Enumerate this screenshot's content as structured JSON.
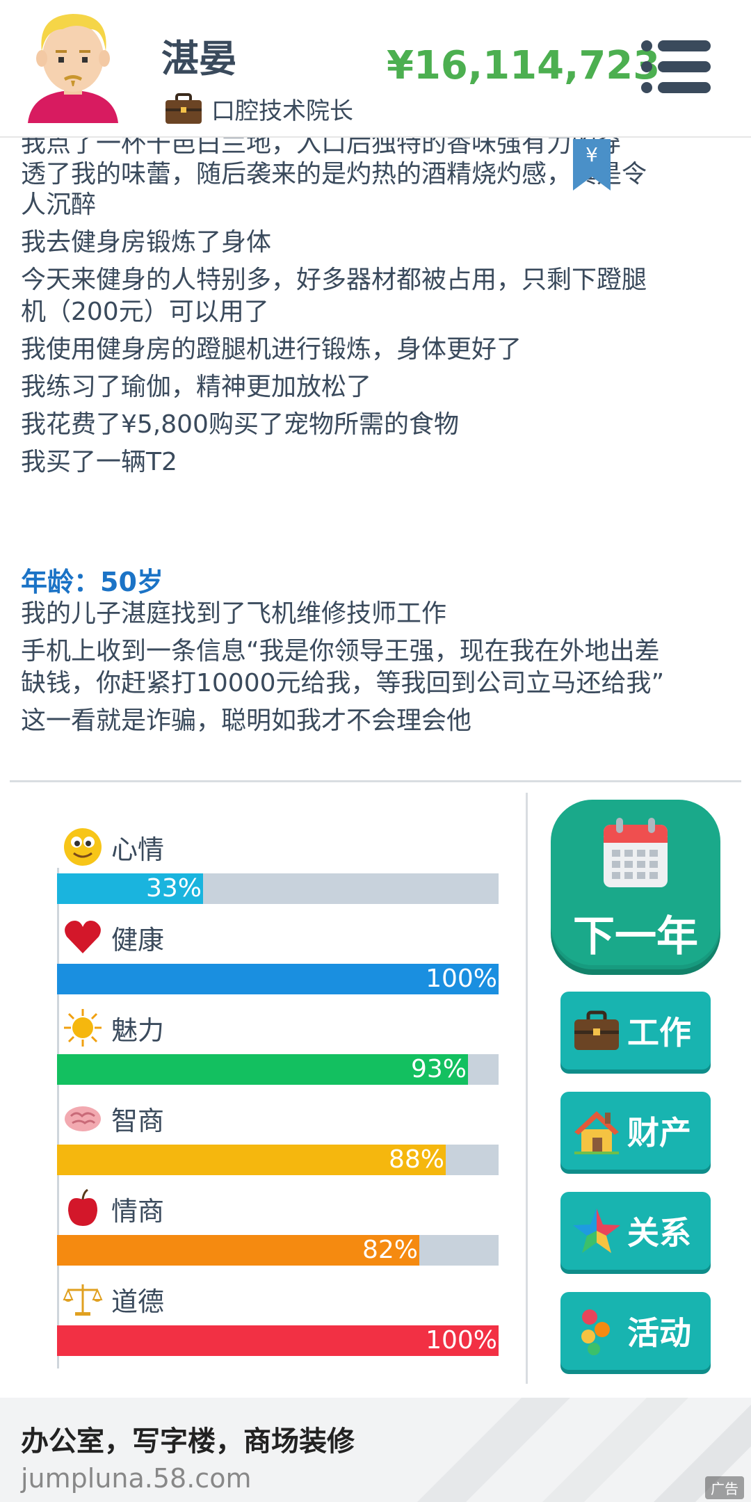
{
  "header": {
    "name": "湛晏",
    "job_title": "口腔技术院长",
    "money": "¥16,114,723"
  },
  "log": {
    "partial_line": "我点了一杯干邑白兰地，入口后独特的香味强有力的穿",
    "lines": [
      "透了我的味蕾，随后袭来的是灼热的酒精烧灼感，真是令",
      "人沉醉",
      "我去健身房锻炼了身体",
      "今天来健身的人特别多，好多器材都被占用，只剩下蹬腿",
      "机（200元）可以用了",
      "我使用健身房的蹬腿机进行锻炼，身体更好了",
      "我练习了瑜伽，精神更加放松了",
      "我花费了¥5,800购买了宠物所需的食物",
      "我买了一辆T2"
    ],
    "age_label": "年龄：50岁",
    "lines2": [
      "我的儿子湛庭找到了飞机维修技师工作",
      "手机上收到一条信息“我是你领导王强，现在我在外地出差",
      "缺钱，你赶紧打10000元给我，等我回到公司立马还给我”",
      "这一看就是诈骗，聪明如我才不会理会他"
    ]
  },
  "stats": [
    {
      "label": "心情",
      "value": 33,
      "pct": "33%",
      "color": "#1ab4de",
      "icon": "smiley-icon"
    },
    {
      "label": "健康",
      "value": 100,
      "pct": "100%",
      "color": "#1a8fe0",
      "icon": "heart-icon"
    },
    {
      "label": "魅力",
      "value": 93,
      "pct": "93%",
      "color": "#13c060",
      "icon": "sun-icon"
    },
    {
      "label": "智商",
      "value": 88,
      "pct": "88%",
      "color": "#f5b70e",
      "icon": "brain-icon"
    },
    {
      "label": "情商",
      "value": 82,
      "pct": "82%",
      "color": "#f58a10",
      "icon": "apple-icon"
    },
    {
      "label": "道德",
      "value": 100,
      "pct": "100%",
      "color": "#f23044",
      "icon": "scales-icon"
    }
  ],
  "buttons": {
    "next_year": "下一年",
    "work": "工作",
    "assets": "财产",
    "relations": "关系",
    "activities": "活动"
  },
  "ad": {
    "title": "办公室，写字楼，商场装修",
    "url": "jumpluna.58.com",
    "badge": "广告"
  }
}
